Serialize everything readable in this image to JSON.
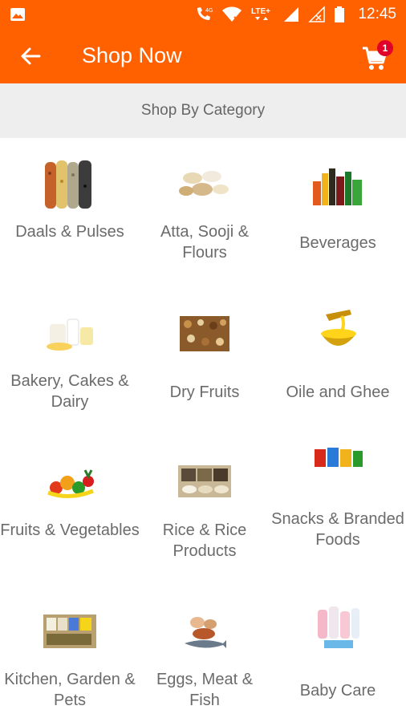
{
  "status_bar": {
    "time": "12:45",
    "icons": [
      "image-icon",
      "call-4g-icon",
      "wifi-icon",
      "lte-icon",
      "signal-icon",
      "signal-empty-icon",
      "battery-icon"
    ]
  },
  "app_bar": {
    "title": "Shop Now",
    "cart_count": "1",
    "color": "#ff6000"
  },
  "section": {
    "title": "Shop By Category"
  },
  "categories": [
    {
      "label": "Daals & Pulses",
      "icon": "daals-pulses-image"
    },
    {
      "label": "Atta, Sooji & Flours",
      "icon": "atta-flours-image"
    },
    {
      "label": "Beverages",
      "icon": "beverages-image"
    },
    {
      "label": "Bakery, Cakes & Dairy",
      "icon": "bakery-dairy-image"
    },
    {
      "label": "Dry Fruits",
      "icon": "dry-fruits-image"
    },
    {
      "label": "Oile and Ghee",
      "icon": "oil-ghee-image"
    },
    {
      "label": "Fruits & Vegetables",
      "icon": "fruits-vegetables-image"
    },
    {
      "label": "Rice & Rice Products",
      "icon": "rice-products-image"
    },
    {
      "label": "Snacks & Branded Foods",
      "icon": "snacks-branded-image"
    },
    {
      "label": "Kitchen, Garden & Pets",
      "icon": "kitchen-garden-pets-image"
    },
    {
      "label": "Eggs, Meat & Fish",
      "icon": "eggs-meat-fish-image"
    },
    {
      "label": "Baby Care",
      "icon": "baby-care-image"
    }
  ]
}
